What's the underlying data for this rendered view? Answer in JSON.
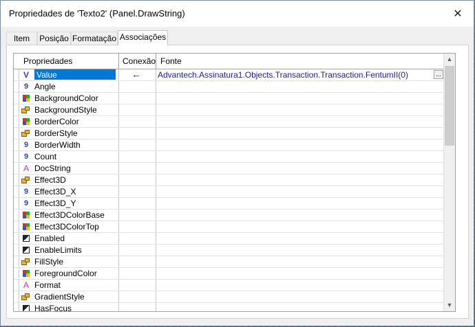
{
  "window": {
    "title": "Propriedades de 'Texto2' (Panel.DrawString)",
    "close_label": "✕"
  },
  "tabs": [
    {
      "label": "Item",
      "active": false
    },
    {
      "label": "Posição",
      "active": false
    },
    {
      "label": "Formatação",
      "active": false
    },
    {
      "label": "Associações",
      "active": true
    }
  ],
  "grid": {
    "headers": {
      "property": "Propriedades",
      "connection": "Conexão",
      "source": "Fonte"
    },
    "rows": [
      {
        "name": "Value",
        "icon": "variant-icon",
        "selected": true,
        "connection": "←",
        "source": "Advantech.Assinatura1.Objects.Transaction.Transaction.FentumII(0)",
        "ellipsis": "..."
      },
      {
        "name": "Angle",
        "icon": "number-icon"
      },
      {
        "name": "BackgroundColor",
        "icon": "color-icon"
      },
      {
        "name": "BackgroundStyle",
        "icon": "style-icon"
      },
      {
        "name": "BorderColor",
        "icon": "color-icon"
      },
      {
        "name": "BorderStyle",
        "icon": "style-icon"
      },
      {
        "name": "BorderWidth",
        "icon": "number-icon"
      },
      {
        "name": "Count",
        "icon": "number-icon"
      },
      {
        "name": "DocString",
        "icon": "text-icon"
      },
      {
        "name": "Effect3D",
        "icon": "style-icon"
      },
      {
        "name": "Effect3D_X",
        "icon": "number-icon"
      },
      {
        "name": "Effect3D_Y",
        "icon": "number-icon"
      },
      {
        "name": "Effect3DColorBase",
        "icon": "color-icon"
      },
      {
        "name": "Effect3DColorTop",
        "icon": "color-icon"
      },
      {
        "name": "Enabled",
        "icon": "boolean-icon"
      },
      {
        "name": "EnableLimits",
        "icon": "boolean-icon"
      },
      {
        "name": "FillStyle",
        "icon": "style-icon"
      },
      {
        "name": "ForegroundColor",
        "icon": "color-icon"
      },
      {
        "name": "Format",
        "icon": "text-icon"
      },
      {
        "name": "GradientStyle",
        "icon": "style-icon"
      },
      {
        "name": "HasFocus",
        "icon": "boolean-icon"
      }
    ]
  },
  "scrollbar": {
    "up": "▲",
    "down": "▼"
  }
}
